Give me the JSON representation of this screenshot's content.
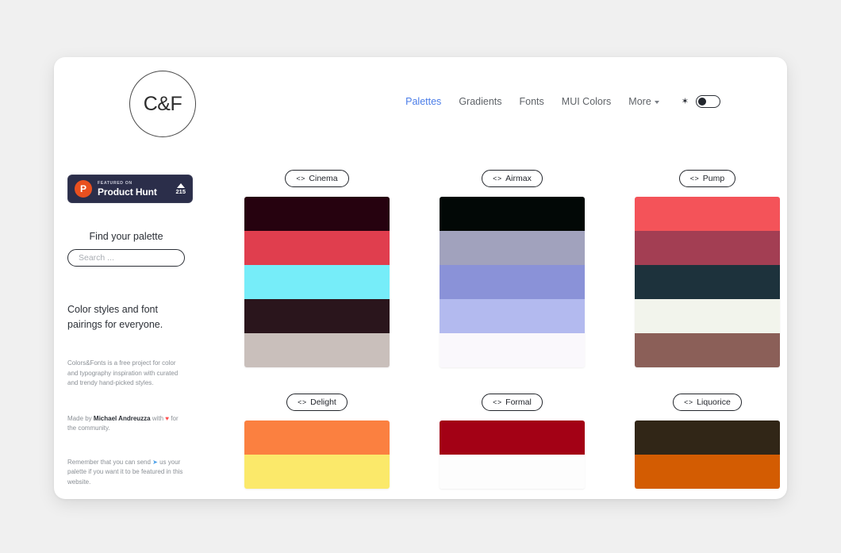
{
  "header": {
    "logo_text": "C&F",
    "nav": [
      {
        "label": "Palettes",
        "active": true
      },
      {
        "label": "Gradients",
        "active": false
      },
      {
        "label": "Fonts",
        "active": false
      },
      {
        "label": "MUI Colors",
        "active": false
      }
    ],
    "more_label": "More",
    "sun_icon": "sun-icon",
    "theme_toggle_state": "light"
  },
  "sidebar": {
    "product_hunt": {
      "featured_label": "FEATURED ON",
      "name": "Product Hunt",
      "vote_count": "215",
      "logo_letter": "P"
    },
    "find_title": "Find your palette",
    "search_placeholder": "Search ...",
    "search_value": "",
    "tagline": "Color styles and font pairings for everyone.",
    "description": "Colors&Fonts is a free project for color and typography inspiration with curated and trendy hand-picked styles.",
    "made_by_prefix": "Made by ",
    "made_by_name": "Michael Andreuzza",
    "made_by_middle": " with ",
    "made_by_heart": "♥",
    "made_by_suffix": " for the community.",
    "remember_prefix": "Remember that you can send ",
    "remember_plane": "➤",
    "remember_suffix": " us your palette if you want it to be featured in this website."
  },
  "palettes": [
    {
      "name": "Cinema",
      "code_icon": "code-brackets-icon",
      "colors": [
        "#26020f",
        "#e03e4e",
        "#76edf9",
        "#2a151c",
        "#c9bfbb"
      ]
    },
    {
      "name": "Airmax",
      "code_icon": "code-brackets-icon",
      "colors": [
        "#020806",
        "#a1a2bd",
        "#8a92d8",
        "#b3baef",
        "#faf8fc"
      ]
    },
    {
      "name": "Pump",
      "code_icon": "code-brackets-icon",
      "colors": [
        "#f45359",
        "#a33e53",
        "#1d323c",
        "#f2f4ec",
        "#8b5f58"
      ]
    },
    {
      "name": "Delight",
      "code_icon": "code-brackets-icon",
      "colors": [
        "#fb8040",
        "#fbe96a"
      ]
    },
    {
      "name": "Formal",
      "code_icon": "code-brackets-icon",
      "colors": [
        "#a30115",
        "#fdfdfd"
      ]
    },
    {
      "name": "Liquorice",
      "code_icon": "code-brackets-icon",
      "colors": [
        "#312617",
        "#d35c02"
      ]
    }
  ],
  "theme": {
    "accent": "#4b7de8",
    "page_background": "#f0f0f0",
    "card_background": "#ffffff",
    "text_dark": "#2b2f36",
    "text_muted": "#8b9096"
  }
}
